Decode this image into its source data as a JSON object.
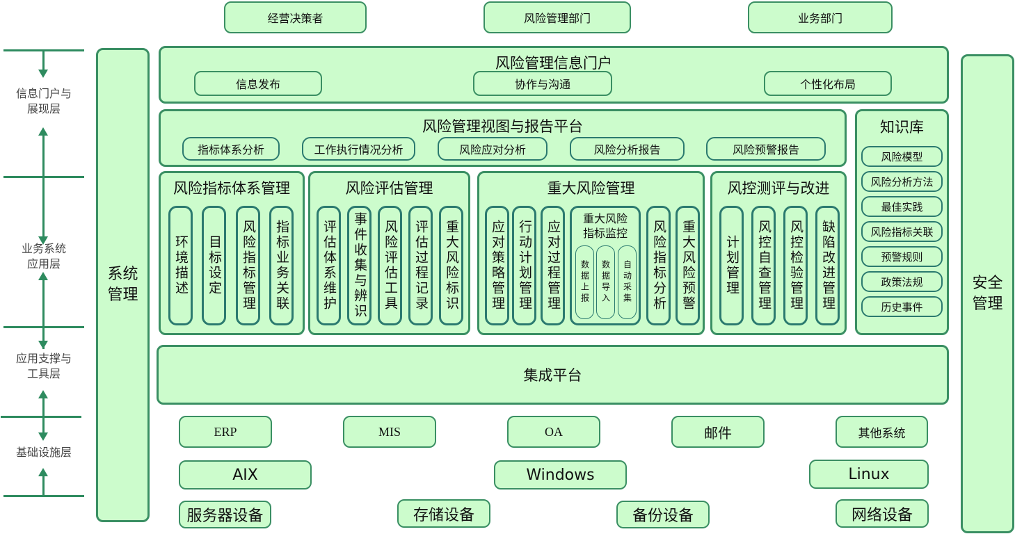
{
  "stakeholders": [
    "经营决策者",
    "风险管理部门",
    "业务部门"
  ],
  "layers": [
    {
      "label": "信息门户与\n展现层"
    },
    {
      "label": "业务系统\n应用层"
    },
    {
      "label": "应用支撑与\n工具层"
    },
    {
      "label": "基础设施层"
    }
  ],
  "side_left": {
    "label": "系统\n管理"
  },
  "side_right": {
    "label": "安全\n管理"
  },
  "portal": {
    "title": "风险管理信息门户",
    "items": [
      "信息发布",
      "协作与沟通",
      "个性化布局"
    ]
  },
  "report_platform": {
    "title": "风险管理视图与报告平台",
    "items": [
      "指标体系分析",
      "工作执行情况分析",
      "风险应对分析",
      "风险分析报告",
      "风险预警报告"
    ]
  },
  "knowledge_base": {
    "title": "知识库",
    "items": [
      "风险模型",
      "风险分析方法",
      "最佳实践",
      "风险指标关联",
      "预警规则",
      "政策法规",
      "历史事件"
    ]
  },
  "modules": [
    {
      "title": "风险指标体系管理",
      "items": [
        "环境描述",
        "目标设定",
        "风险指标管理",
        "指标业务关联"
      ]
    },
    {
      "title": "风险评估管理",
      "items": [
        "评估体系维护",
        "事件收集与辨识",
        "风险评估工具",
        "评估过程记录",
        "重大风险标识"
      ]
    },
    {
      "title": "重大风险管理",
      "items": [
        "应对策略管理",
        "行动计划管理",
        "应对过程管理"
      ],
      "monitor": {
        "title": "重大风险\n指标监控",
        "items": [
          "数据上报",
          "数据导入",
          "自动采集"
        ]
      },
      "items_after": [
        "风险指标分析",
        "重大风险预警"
      ]
    },
    {
      "title": "风控测评与改进",
      "items": [
        "计划管理",
        "风控自查管理",
        "风控检验管理",
        "缺陷改进管理"
      ]
    }
  ],
  "integration": {
    "title": "集成平台"
  },
  "systems": [
    "ERP",
    "MIS",
    "OA",
    "邮件",
    "其他系统"
  ],
  "os": [
    "AIX",
    "Windows",
    "Linux"
  ],
  "devices": [
    "服务器设备",
    "存储设备",
    "备份设备",
    "网络设备"
  ],
  "colors": {
    "fill": "#ccfccc",
    "border": "#3a8f63",
    "inner_border": "#2b7a6f",
    "arrow": "#2e8b5f"
  }
}
